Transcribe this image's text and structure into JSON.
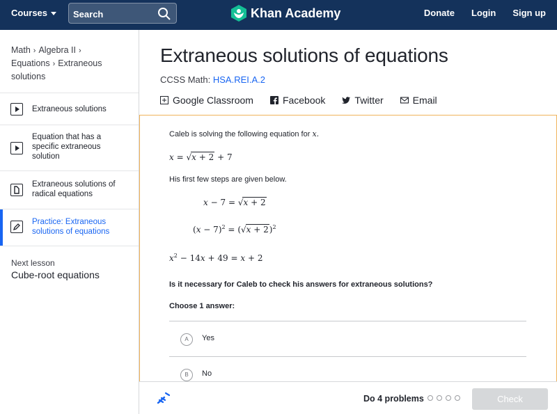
{
  "topnav": {
    "courses_label": "Courses",
    "search_placeholder": "Search",
    "logo_text": "Khan Academy",
    "links": {
      "donate": "Donate",
      "login": "Login",
      "signup": "Sign up"
    }
  },
  "sidebar": {
    "breadcrumb": {
      "math": "Math",
      "algebra2": "Algebra II",
      "equations": "Equations",
      "extraneous": "Extraneous solutions"
    },
    "items": [
      {
        "label": "Extraneous solutions",
        "type": "video"
      },
      {
        "label": "Equation that has a specific extraneous solution",
        "type": "video"
      },
      {
        "label": "Extraneous solutions of radical equations",
        "type": "article"
      },
      {
        "label": "Practice: Extraneous solutions of equations",
        "type": "practice",
        "active": true
      }
    ],
    "next_lesson_label": "Next lesson",
    "next_lesson_title": "Cube-root equations"
  },
  "header": {
    "title": "Extraneous solutions of equations",
    "ccss_label": "CCSS Math:",
    "ccss_code": "HSA.REI.A.2",
    "share": {
      "classroom": "Google Classroom",
      "facebook": "Facebook",
      "twitter": "Twitter",
      "email": "Email"
    }
  },
  "exercise": {
    "intro": "Caleb is solving the following equation for",
    "intro_var": "x.",
    "first_steps": "His first few steps are given below.",
    "question": "Is it necessary for Caleb to check his answers for extraneous solutions?",
    "choose_label": "Choose 1 answer:",
    "choices": [
      {
        "letter": "A",
        "label": "Yes"
      },
      {
        "letter": "B",
        "label": "No"
      }
    ]
  },
  "footer": {
    "do_problems": "Do 4 problems",
    "check_label": "Check",
    "progress_total": 4,
    "progress_done": 0
  },
  "colors": {
    "nav_bg": "#14325b",
    "accent": "#1865f2",
    "panel_border": "#f0b35b",
    "check_disabled": "#d6d8da"
  }
}
